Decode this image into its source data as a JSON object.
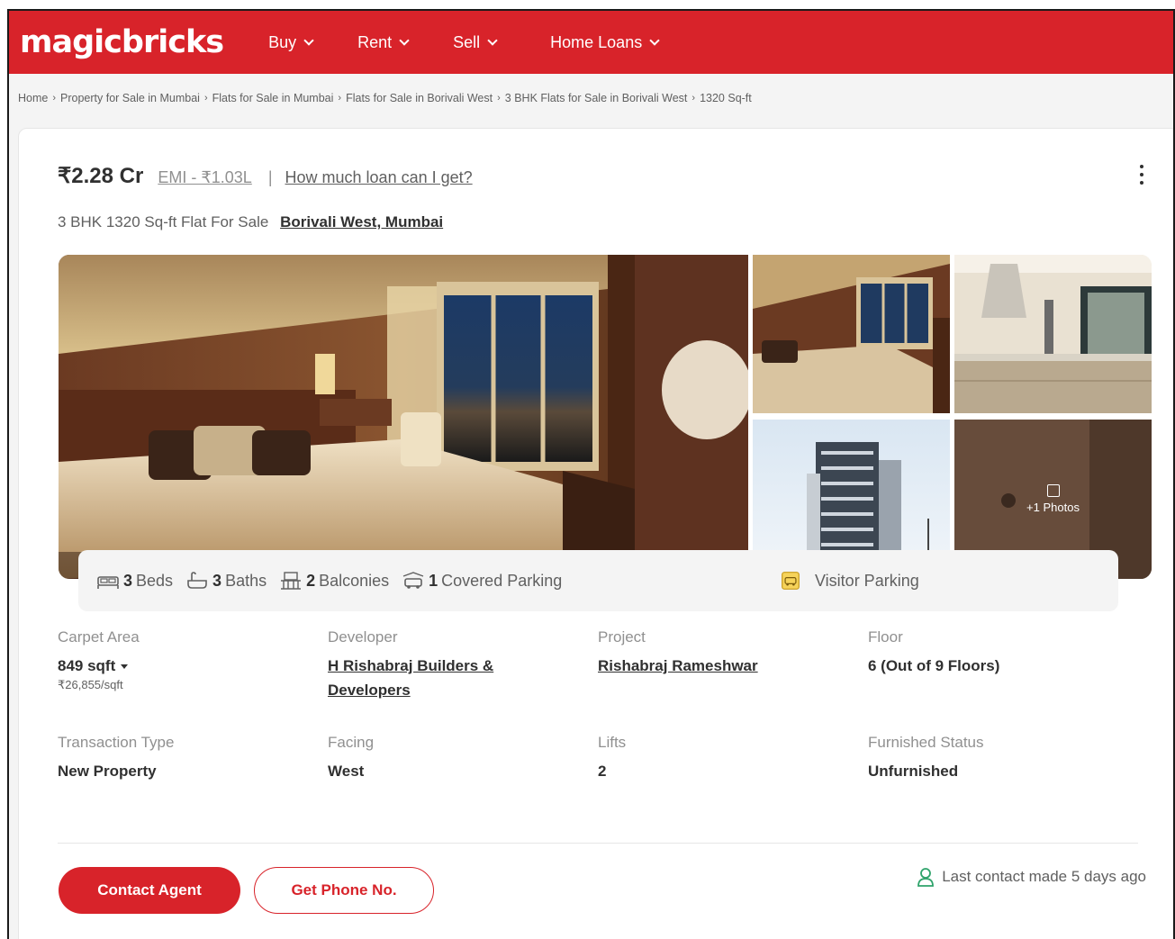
{
  "header": {
    "logo": "magicbricks",
    "nav": [
      {
        "label": "Buy"
      },
      {
        "label": "Rent"
      },
      {
        "label": "Sell"
      },
      {
        "label": "Home Loans"
      }
    ]
  },
  "breadcrumb": [
    "Home",
    "Property for Sale in Mumbai",
    "Flats for Sale in Mumbai",
    "Flats for Sale in Borivali West",
    "3 BHK Flats for Sale in Borivali West",
    "1320 Sq-ft"
  ],
  "listing": {
    "price": "₹2.28 Cr",
    "emi": "EMI - ₹1.03L",
    "loan_link": "How much loan can I get?",
    "title": "3 BHK 1320 Sq-ft Flat For Sale",
    "location": "Borivali West, Mumbai"
  },
  "gallery": {
    "more_photos": "+1 Photos"
  },
  "amenities": {
    "beds_count": "3",
    "beds_label": "Beds",
    "baths_count": "3",
    "baths_label": "Baths",
    "balconies_count": "2",
    "balconies_label": "Balconies",
    "parking_count": "1",
    "parking_label": "Covered Parking",
    "visitor_parking": "Visitor Parking"
  },
  "details": {
    "carpet_area": {
      "label": "Carpet Area",
      "value": "849 sqft",
      "sub": "₹26,855/sqft"
    },
    "developer": {
      "label": "Developer",
      "value": "H Rishabraj Builders & Developers"
    },
    "project": {
      "label": "Project",
      "value": "Rishabraj Rameshwar"
    },
    "floor": {
      "label": "Floor",
      "value": "6 (Out of 9 Floors)"
    },
    "transaction": {
      "label": "Transaction Type",
      "value": "New Property"
    },
    "facing": {
      "label": "Facing",
      "value": "West"
    },
    "lifts": {
      "label": "Lifts",
      "value": "2"
    },
    "furnished": {
      "label": "Furnished Status",
      "value": "Unfurnished"
    }
  },
  "actions": {
    "contact_agent": "Contact Agent",
    "get_phone": "Get Phone No.",
    "last_contact": "Last contact made 5 days ago"
  },
  "colors": {
    "brand_red": "#d8232a",
    "contact_icon_green": "#2fa36b"
  }
}
